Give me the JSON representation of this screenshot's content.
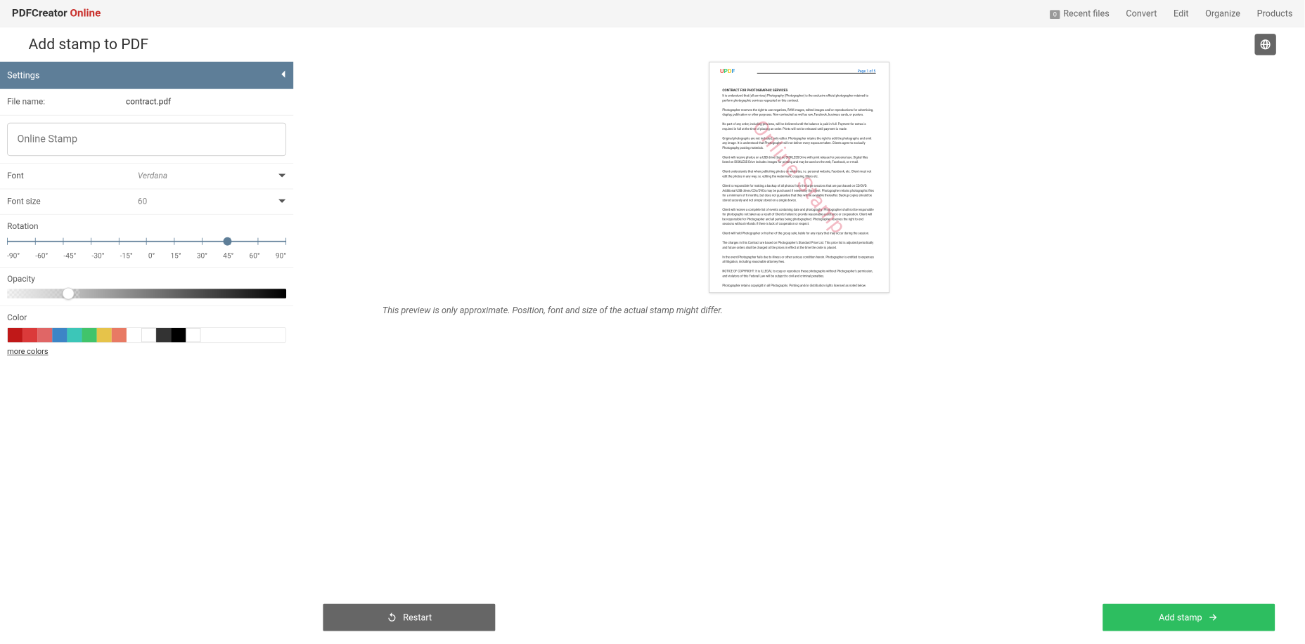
{
  "brand": {
    "p1": "PDFCreator ",
    "p2": "Online"
  },
  "nav": {
    "recent_badge": "0",
    "recent": "Recent files",
    "convert": "Convert",
    "edit": "Edit",
    "organize": "Organize",
    "products": "Products"
  },
  "page_title": "Add stamp to PDF",
  "sidebar": {
    "title": "Settings",
    "file_name_label": "File name:",
    "file_name": "contract.pdf",
    "stamp_text": "Online Stamp",
    "font_label": "Font",
    "font_value": "Verdana",
    "size_label": "Font size",
    "size_value": "60",
    "rotation_label": "Rotation",
    "rotation_ticks": [
      "-90°",
      "-60°",
      "-45°",
      "-30°",
      "-15°",
      "0°",
      "15°",
      "30°",
      "45°",
      "60°",
      "90°"
    ],
    "rotation_value": 52,
    "opacity_label": "Opacity",
    "opacity_value": 22,
    "color_label": "Color",
    "colors": [
      "#c01818",
      "#db3a3a",
      "#e06666",
      "#3d85c6",
      "#3cc6b8",
      "#41c46b",
      "#e6c34a",
      "#e87a64",
      "#ffffff",
      "#333333",
      "#000000",
      "#ffffff"
    ],
    "more_colors": "more colors"
  },
  "preview": {
    "disclaimer": "This preview is only approximate. Position, font and size of the actual stamp might differ.",
    "doc_title": "CONTRACT FOR PHOTOGRAPHIC SERVICES",
    "page_indicator": "Page 1 of 5",
    "stamp_overlay": "Online Stamp"
  },
  "buttons": {
    "restart": "Restart",
    "add": "Add stamp"
  }
}
